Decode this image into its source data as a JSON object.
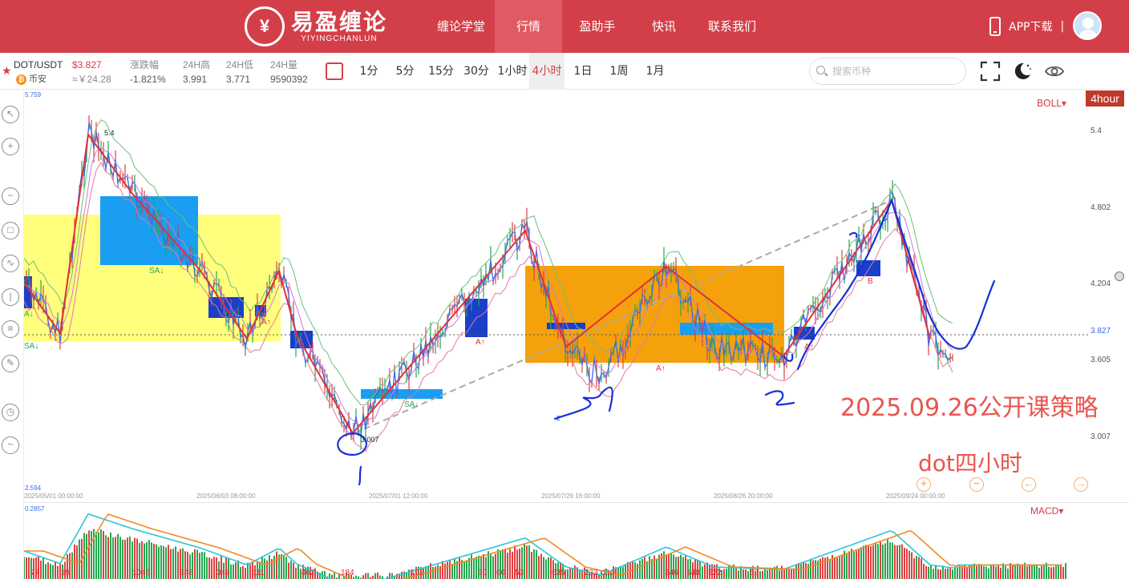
{
  "nav": {
    "logo_cn": "易盈缠论",
    "logo_en": "YIYINGCHANLUN",
    "items": [
      {
        "label": "缠论学堂"
      },
      {
        "label": "行情"
      },
      {
        "label": "盈助手"
      },
      {
        "label": "快讯"
      },
      {
        "label": "联系我们"
      }
    ],
    "active_index": 1,
    "app_download": "APP下载",
    "separator": "|"
  },
  "ticker": {
    "symbol": "DOT/USDT",
    "price": "$3.827",
    "exchange": "币安",
    "cny": "≈￥24.28",
    "change_label": "涨跌幅",
    "change_value": "-1.821%",
    "high_label": "24H高",
    "high_value": "3.991",
    "low_label": "24H低",
    "low_value": "3.771",
    "vol_label": "24H量",
    "vol_value": "9590392"
  },
  "periods": [
    "1分",
    "5分",
    "15分",
    "30分",
    "1小时",
    "4小时",
    "1日",
    "1周",
    "1月"
  ],
  "active_period": 5,
  "search": {
    "placeholder": "搜索币种"
  },
  "chart": {
    "indicator": "BOLL▾",
    "timeframe_badge": "4hour",
    "macd_label": "MACD▾",
    "scale_top": "5.759",
    "scale_bottom": "2.594",
    "macd_top": "0.2857",
    "price_labels": [
      {
        "value": "5.4"
      },
      {
        "value": "4.802"
      },
      {
        "value": "4.204"
      },
      {
        "value": "3.605"
      },
      {
        "value": "3.007"
      }
    ],
    "current_price": "3.827",
    "dates": [
      "2025/05/01 00:00:00",
      "2025/06/03 08:00:00",
      "2025/07/01 12:00:00",
      "2025/07/29 16:00:00",
      "2025/08/26 20:00:00",
      "2025/09/24 00:00:00"
    ],
    "annotations": {
      "high_label": "5.4",
      "low_label": "3.007",
      "sa_labels": [
        "SA↓",
        "SA↓",
        "A↓",
        "SA↓"
      ],
      "a_up": [
        "A↑",
        "A↑",
        "A↑",
        "A↑"
      ],
      "b_label": "B"
    },
    "hand_marks": [
      "1",
      "2",
      "2'"
    ],
    "strategy_text": "2025.09.26公开课策略",
    "dot_text": "dot四小时",
    "macd_numbers": [
      "77",
      "19",
      "1046",
      "348",
      "348",
      "111",
      "462",
      "184",
      "102",
      "60",
      "60",
      "53",
      "635",
      "233",
      "110",
      "346",
      "148",
      "322",
      "58"
    ],
    "colors": {
      "nav_red": "#d33f49",
      "yellow_box": "#ffff66",
      "blue_box": "#1a9ef2",
      "orange_box": "#f5a10c",
      "zig_red": "#e0303a",
      "pen_blue": "#1530d8"
    }
  },
  "zoom_buttons": [
    "+",
    "−",
    "←",
    "→"
  ]
}
